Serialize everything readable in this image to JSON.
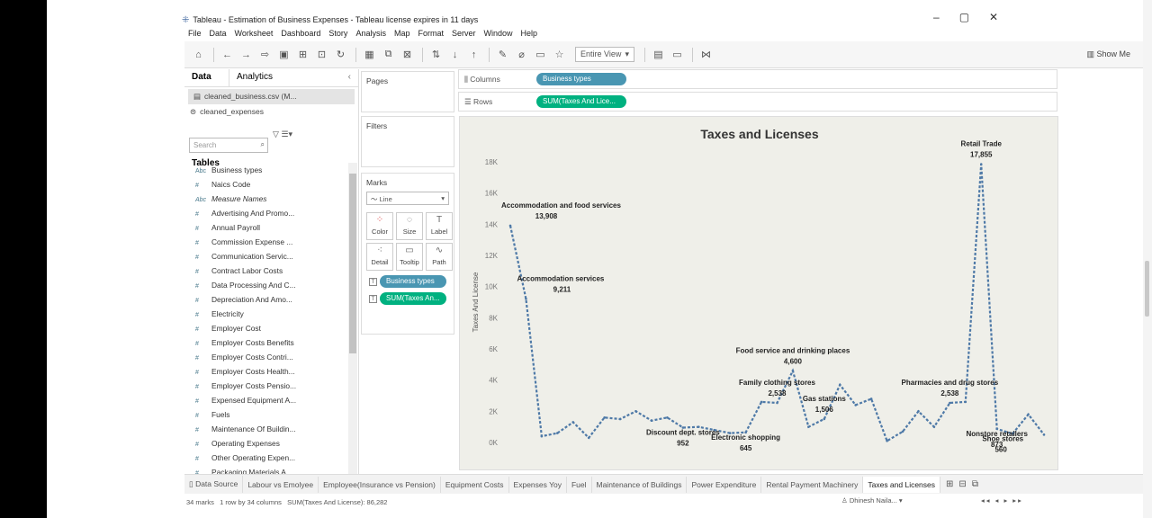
{
  "window": {
    "title": "Tableau - Estimation of Business Expenses - Tableau license expires in 11 days",
    "minimize": "–",
    "maximize": "▢",
    "close": "✕"
  },
  "menu": [
    "File",
    "Data",
    "Worksheet",
    "Dashboard",
    "Story",
    "Analysis",
    "Map",
    "Format",
    "Server",
    "Window",
    "Help"
  ],
  "toolbar": {
    "fit_value": "Entire View",
    "show_me": "Show Me"
  },
  "left_pane": {
    "tab_data": "Data",
    "tab_analytics": "Analytics",
    "data_source_1": "cleaned_business.csv (M...",
    "data_source_2": "cleaned_expenses",
    "search_placeholder": "Search",
    "tables_heading": "Tables",
    "fields": [
      {
        "type": "Abc",
        "name": "Business types",
        "italic": false
      },
      {
        "type": "#",
        "name": "Naics Code",
        "italic": false
      },
      {
        "type": "Abc",
        "name": "Measure Names",
        "italic": true
      },
      {
        "type": "#",
        "name": "Advertising And Promo...",
        "italic": false
      },
      {
        "type": "#",
        "name": "Annual Payroll",
        "italic": false
      },
      {
        "type": "#",
        "name": "Commission Expense ...",
        "italic": false
      },
      {
        "type": "#",
        "name": "Communication Servic...",
        "italic": false
      },
      {
        "type": "#",
        "name": "Contract Labor Costs",
        "italic": false
      },
      {
        "type": "#",
        "name": "Data Processing And C...",
        "italic": false
      },
      {
        "type": "#",
        "name": "Depreciation And Amo...",
        "italic": false
      },
      {
        "type": "#",
        "name": "Electricity",
        "italic": false
      },
      {
        "type": "#",
        "name": "Employer Cost",
        "italic": false
      },
      {
        "type": "#",
        "name": "Employer Costs Benefits",
        "italic": false
      },
      {
        "type": "#",
        "name": "Employer Costs Contri...",
        "italic": false
      },
      {
        "type": "#",
        "name": "Employer Costs Health...",
        "italic": false
      },
      {
        "type": "#",
        "name": "Employer Costs Pensio...",
        "italic": false
      },
      {
        "type": "#",
        "name": "Expensed Equipment A...",
        "italic": false
      },
      {
        "type": "#",
        "name": "Fuels",
        "italic": false
      },
      {
        "type": "#",
        "name": "Maintenance Of Buildin...",
        "italic": false
      },
      {
        "type": "#",
        "name": "Operating Expenses",
        "italic": false
      },
      {
        "type": "#",
        "name": "Other Operating Expen...",
        "italic": false
      },
      {
        "type": "#",
        "name": "Packaging Materials A...",
        "italic": false
      }
    ]
  },
  "cards": {
    "pages": "Pages",
    "filters": "Filters",
    "marks": "Marks",
    "mark_type": "Line",
    "mark_buttons": [
      "Color",
      "Size",
      "Label",
      "Detail",
      "Tooltip",
      "Path"
    ],
    "mark_pill_1": "Business types",
    "mark_pill_2": "SUM(Taxes An..."
  },
  "shelves": {
    "columns_label": "Columns",
    "columns_pill": "Business types",
    "rows_label": "Rows",
    "rows_pill": "SUM(Taxes And Lice..."
  },
  "chart_data": {
    "type": "line",
    "title": "Taxes and Licenses",
    "ylabel": "Taxes And License",
    "ylim": [
      0,
      18000
    ],
    "y_ticks": [
      "0K",
      "2K",
      "4K",
      "6K",
      "8K",
      "10K",
      "12K",
      "14K",
      "16K",
      "18K"
    ],
    "color": "#4e79a7",
    "series": [
      {
        "name": "SUM(Taxes And License)",
        "values": [
          13908,
          9211,
          400,
          600,
          1300,
          300,
          1600,
          1500,
          2000,
          1400,
          1600,
          952,
          1000,
          800,
          600,
          645,
          2600,
          2538,
          4600,
          1000,
          1506,
          3700,
          2400,
          2800,
          100,
          700,
          2000,
          1000,
          2538,
          2600,
          17855,
          873,
          560,
          1800,
          500
        ]
      }
    ],
    "annotations": [
      {
        "index": 0,
        "label": "Accommodation and food services",
        "value": "13,908"
      },
      {
        "index": 1,
        "label": "Accommodation services",
        "value": "9,211"
      },
      {
        "index": 11,
        "label": "Discount dept. stores",
        "value": "952"
      },
      {
        "index": 15,
        "label": "Electronic shopping",
        "value": "645"
      },
      {
        "index": 17,
        "label": "Family clothing stores",
        "value": "2,538"
      },
      {
        "index": 18,
        "label": "Food service and drinking places",
        "value": "4,600"
      },
      {
        "index": 20,
        "label": "Gas stations",
        "value": "1,506"
      },
      {
        "index": 28,
        "label": "Pharmacies and drug stores",
        "value": "2,538"
      },
      {
        "index": 30,
        "label": "Retail Trade",
        "value": "17,855"
      },
      {
        "index": 31,
        "label": "Nonstore retailers",
        "value": "873"
      },
      {
        "index": 32,
        "label": "Shoe stores",
        "value": "560"
      }
    ]
  },
  "sheet_tabs": [
    "Data Source",
    "Labour vs Emolyee",
    "Employee(Insurance vs Pension)",
    "Equipment Costs",
    "Expenses Yoy",
    "Fuel",
    "Maintenance of Buildings",
    "Power Expenditure",
    "Rental Payment Machinery",
    "Taxes and Licenses"
  ],
  "status": {
    "marks": "34 marks",
    "rows_cols": "1 row by 34 columns",
    "sum": "SUM(Taxes And License): 86,282",
    "user": "Dhinesh Naila...",
    "nav": "◂◂ ◂ ▸ ▸▸"
  }
}
